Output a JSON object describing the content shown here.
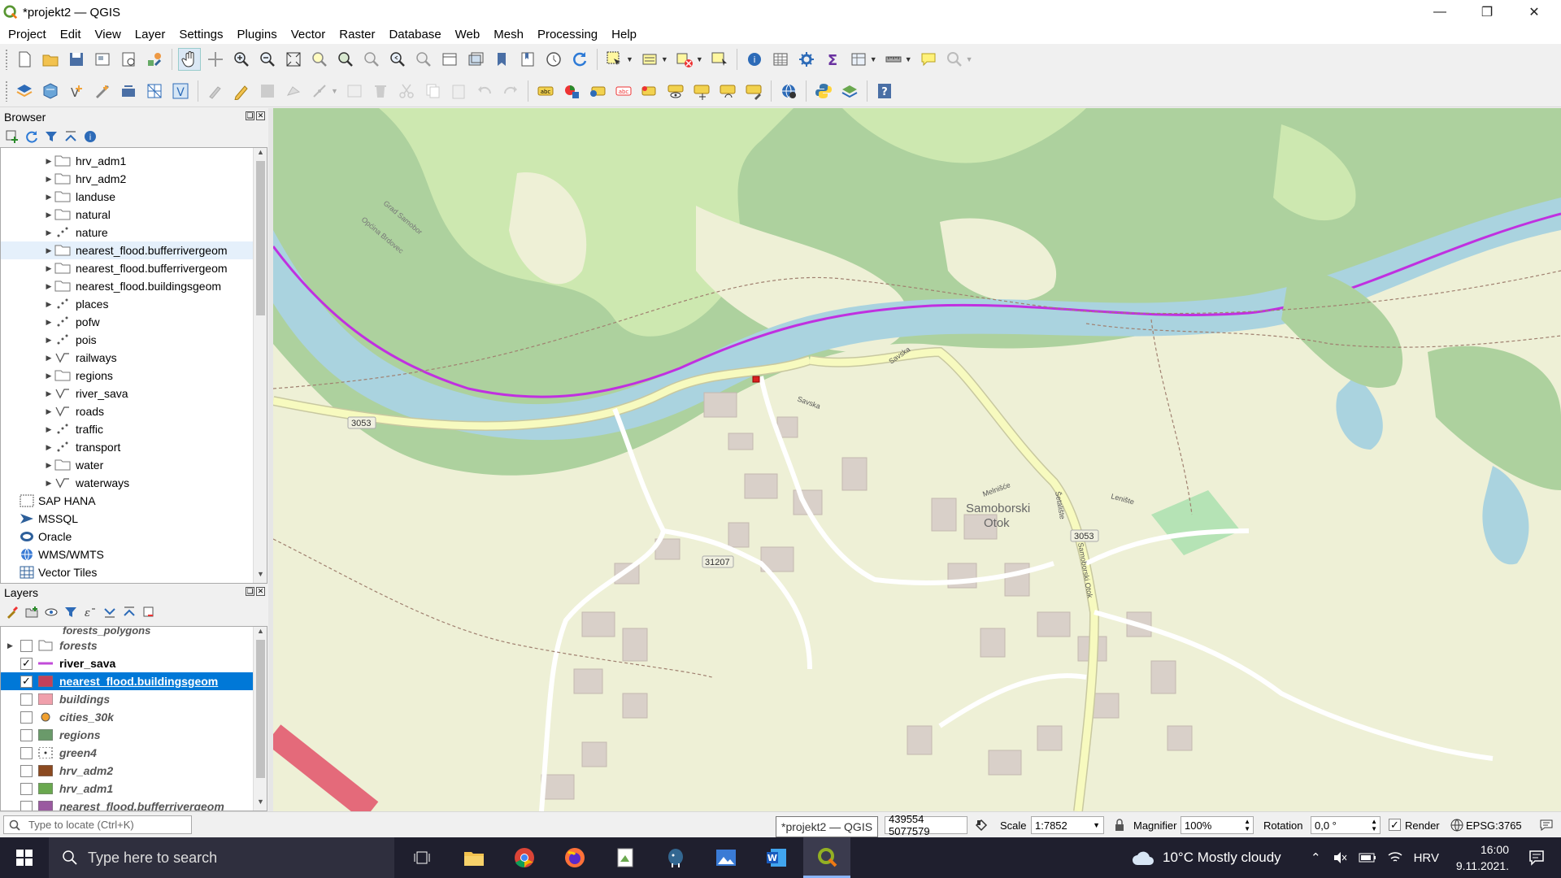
{
  "window": {
    "title": "*projekt2 — QGIS"
  },
  "menu": [
    "Project",
    "Edit",
    "View",
    "Layer",
    "Settings",
    "Plugins",
    "Vector",
    "Raster",
    "Database",
    "Web",
    "Mesh",
    "Processing",
    "Help"
  ],
  "browser": {
    "title": "Browser",
    "items": [
      {
        "label": "hrv_adm1",
        "type": "polygon"
      },
      {
        "label": "hrv_adm2",
        "type": "polygon"
      },
      {
        "label": "landuse",
        "type": "polygon"
      },
      {
        "label": "natural",
        "type": "polygon"
      },
      {
        "label": "nature",
        "type": "point"
      },
      {
        "label": "nearest_flood.bufferrivergeom",
        "type": "polygon"
      },
      {
        "label": "nearest_flood.bufferrivergeom",
        "type": "polygon"
      },
      {
        "label": "nearest_flood.buildingsgeom",
        "type": "polygon"
      },
      {
        "label": "places",
        "type": "point"
      },
      {
        "label": "pofw",
        "type": "point"
      },
      {
        "label": "pois",
        "type": "point"
      },
      {
        "label": "railways",
        "type": "line"
      },
      {
        "label": "regions",
        "type": "polygon"
      },
      {
        "label": "river_sava",
        "type": "line"
      },
      {
        "label": "roads",
        "type": "line"
      },
      {
        "label": "traffic",
        "type": "point"
      },
      {
        "label": "transport",
        "type": "point"
      },
      {
        "label": "water",
        "type": "polygon"
      },
      {
        "label": "waterways",
        "type": "line"
      }
    ],
    "providers": [
      "SAP HANA",
      "MSSQL",
      "Oracle",
      "WMS/WMTS",
      "Vector Tiles"
    ]
  },
  "layers": {
    "title": "Layers",
    "partial_top": "forests_polygons",
    "items": [
      {
        "label": "forests",
        "checked": false,
        "color": "#ffffff",
        "kind": "group"
      },
      {
        "label": "river_sava",
        "checked": true,
        "color": "#c24bd9",
        "kind": "line"
      },
      {
        "label": "nearest_flood.buildingsgeom",
        "checked": true,
        "color": "#c2405a",
        "kind": "fill"
      },
      {
        "label": "buildings",
        "checked": false,
        "color": "#f0a0ac",
        "kind": "fill"
      },
      {
        "label": "cities_30k",
        "checked": false,
        "color": "#f0a030",
        "kind": "point"
      },
      {
        "label": "regions",
        "checked": false,
        "color": "#6a9a6a",
        "kind": "fill"
      },
      {
        "label": "green4",
        "checked": false,
        "color": "#333333",
        "kind": "dots"
      },
      {
        "label": "hrv_adm2",
        "checked": false,
        "color": "#8b4a20",
        "kind": "fill"
      },
      {
        "label": "hrv_adm1",
        "checked": false,
        "color": "#6aa84f",
        "kind": "fill"
      },
      {
        "label": "nearest_flood.bufferrivergeom",
        "checked": false,
        "color": "#9a5aa0",
        "kind": "fill"
      }
    ]
  },
  "map": {
    "labels": {
      "road1": "3053",
      "road2": "3053",
      "road3": "31207",
      "place": "Samoborski",
      "place2": "Otok",
      "street1": "Savska",
      "street2": "Savska",
      "street3": "Melnišće",
      "street4": "Lenište",
      "street5": "Samoborski Otok",
      "street6": "Šetalište",
      "street7": "Grad Samobor",
      "street8": "Općina Brdovec"
    },
    "colors": {
      "river": "#aad3df",
      "river_line": "#c030e0",
      "forest": "#add19e",
      "farmland": "#eef0d6",
      "road": "#f7fabf",
      "building": "#d9d0c9"
    }
  },
  "status": {
    "locator_placeholder": "Type to locate (Ctrl+K)",
    "tooltip": "*projekt2 — QGIS",
    "coordinate": "439554 5077579",
    "scale_label": "Scale",
    "scale": "1:7852",
    "magnifier_label": "Magnifier",
    "magnifier": "100%",
    "rotation_label": "Rotation",
    "rotation": "0,0 °",
    "render_label": "Render",
    "crs": "EPSG:3765"
  },
  "taskbar": {
    "search_placeholder": "Type here to search",
    "weather": "10°C  Mostly cloudy",
    "lang": "HRV",
    "time": "16:00",
    "date": "9.11.2021."
  }
}
